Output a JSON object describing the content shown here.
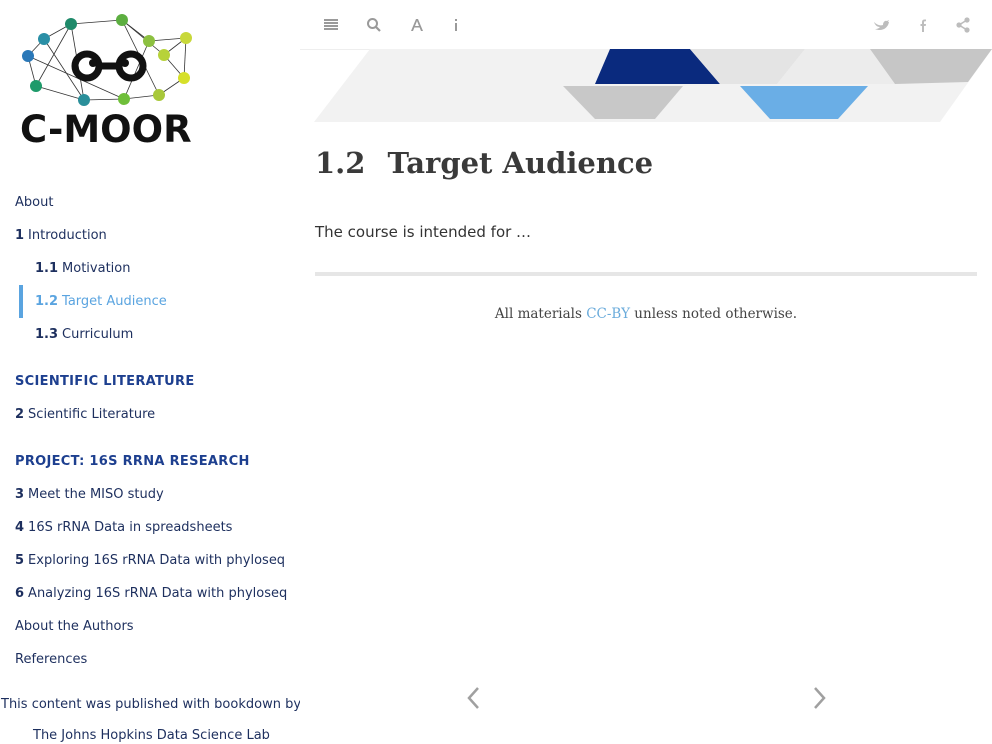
{
  "logo": {
    "text": "C-MOOR"
  },
  "sidebar": {
    "about": "About",
    "intro_num": "1",
    "intro": "Introduction",
    "motivation_num": "1.1",
    "motivation": "Motivation",
    "target_num": "1.2",
    "target": "Target Audience",
    "curriculum_num": "1.3",
    "curriculum": "Curriculum",
    "section_sci": "SCIENTIFIC LITERATURE",
    "sci_num": "2",
    "sci": "Scientific Literature",
    "section_project": "PROJECT: 16S RRNA RESEARCH",
    "ch3_num": "3",
    "ch3": "Meet the MISO study",
    "ch4_num": "4",
    "ch4": "16S rRNA Data in spreadsheets",
    "ch5_num": "5",
    "ch5": "Exploring 16S rRNA Data with phyloseq",
    "ch6_num": "6",
    "ch6": "Analyzing 16S rRNA Data with phyloseq",
    "authors": "About the Authors",
    "references": "References",
    "published": "This content was published with bookdown by:",
    "jhu": "The Johns Hopkins Data Science Lab"
  },
  "toolbar": {
    "icons": [
      "menu-icon",
      "search-icon",
      "font-icon",
      "info-icon",
      "twitter-icon",
      "facebook-icon",
      "share-icon"
    ]
  },
  "main": {
    "section_number": "1.2",
    "title": "Target Audience",
    "body": "The course is intended for …",
    "license_pre": "All materials ",
    "license_link": "CC-BY",
    "license_post": " unless noted otherwise."
  },
  "colors": {
    "nav_text": "#1d2f5e",
    "section_head": "#1d3f8f",
    "active": "#5aa4e0",
    "banner_dark": "#0a2a7e",
    "banner_light": "#6aaee6"
  }
}
